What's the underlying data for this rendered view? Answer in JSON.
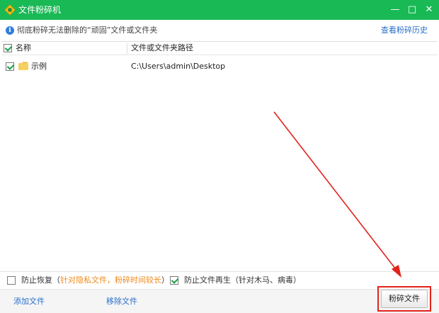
{
  "window": {
    "title": "文件粉碎机",
    "minimize_glyph": "—",
    "maximize_glyph": "□",
    "close_glyph": "✕"
  },
  "info": {
    "icon": "info-icon",
    "icon_glyph": "i",
    "text": "彻底粉碎无法删除的“顽固”文件或文件夹",
    "history_link": "查看粉碎历史"
  },
  "table": {
    "columns": {
      "name": "名称",
      "path": "文件或文件夹路径"
    },
    "header_checked": true,
    "rows": [
      {
        "name": "示例",
        "path": "C:\\Users\\admin\\Desktop",
        "checked": true,
        "icon": "folder-icon"
      }
    ]
  },
  "options": {
    "prevent_recovery": {
      "label": "防止恢复（",
      "note": "针对隐私文件，粉碎时间较长",
      "suffix": "）",
      "checked": false
    },
    "prevent_regeneration": {
      "label": "防止文件再生（针对木马、病毒）",
      "checked": true
    }
  },
  "bottom": {
    "add_link": "添加文件",
    "remove_link": "移除文件",
    "shred_button": "粉碎文件"
  },
  "colors": {
    "titlebar": "#19b955",
    "link": "#2a6fc9",
    "note": "#f08a1c",
    "annotation": "#e2231a"
  }
}
